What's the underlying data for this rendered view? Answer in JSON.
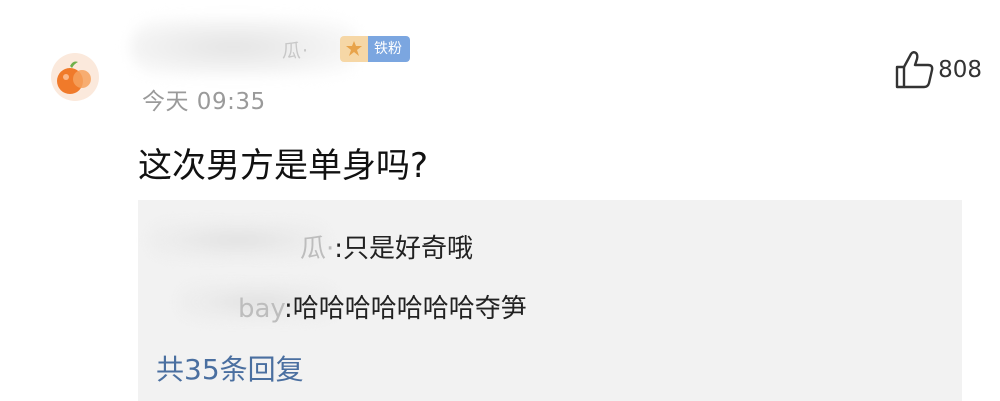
{
  "comment": {
    "username_visible": "瓜·",
    "fan_badge": "铁粉",
    "timestamp": "今天 09:35",
    "like_count": "808",
    "text": "这次男方是单身吗?"
  },
  "replies": [
    {
      "name_visible": "瓜·",
      "separator": ":",
      "text": "只是好奇哦"
    },
    {
      "name_visible": "bay",
      "separator": ":",
      "text": "哈哈哈哈哈哈哈夺笋"
    }
  ],
  "reply_count_label": "共35条回复",
  "colors": {
    "link_blue": "#4a6fa0",
    "badge_blue": "#7ba6e0",
    "reply_bg": "#f2f2f2"
  },
  "icons": {
    "avatar": "orange-fruit-avatar",
    "like": "thumbs-up-icon",
    "badge": "fan-badge-icon"
  }
}
